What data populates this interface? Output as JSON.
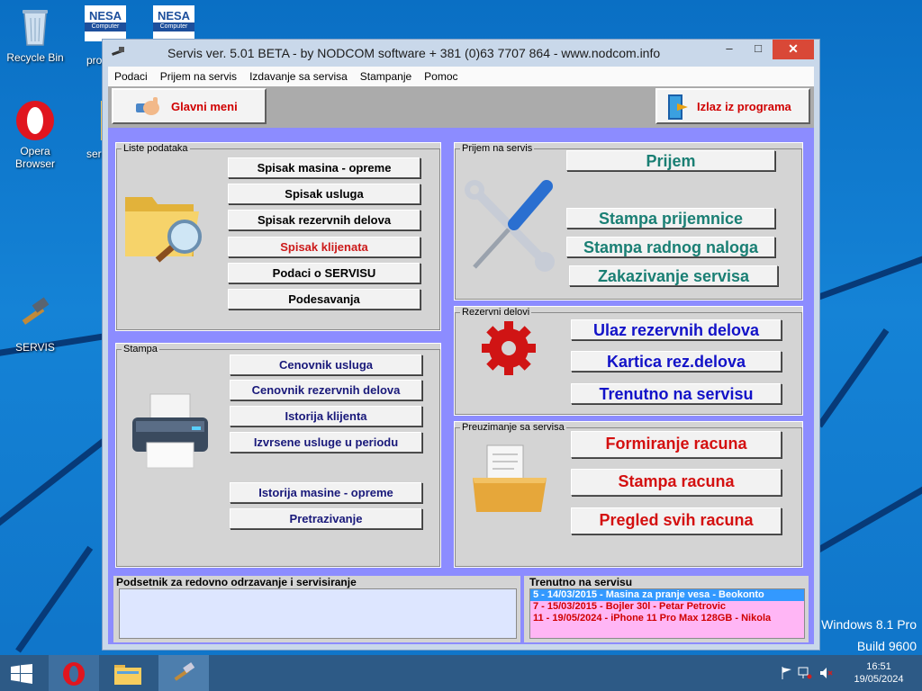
{
  "desktop": {
    "icons": {
      "recycle": "Recycle Bin",
      "nesa1": "NESA",
      "nesa1_sub": "Computer",
      "nesa1_label": "pro",
      "nesa2": "NESA",
      "nesa2_sub": "Computer",
      "opera": "Opera Browser",
      "folder_label": "ser",
      "servis": "SERVIS"
    },
    "watermark_line1": "Windows 8.1 Pro",
    "watermark_line2": "Build 9600"
  },
  "window": {
    "title": "Servis ver. 5.01 BETA - by NODCOM software  + 381 (0)63 7707 864 - www.nodcom.info",
    "controls": {
      "minimize": "–",
      "maximize": "□",
      "close": "✕"
    },
    "menu": [
      "Podaci",
      "Prijem na servis",
      "Izdavanje sa servisa",
      "Stampanje",
      "Pomoc"
    ],
    "toolbar": {
      "main_menu": "Glavni meni",
      "exit": "Izlaz iz programa"
    }
  },
  "panels": {
    "liste": {
      "caption": "Liste podataka",
      "buttons": [
        "Spisak masina - opreme",
        "Spisak usluga",
        "Spisak rezervnih delova",
        "Spisak klijenata",
        "Podaci o SERVISU",
        "Podesavanja"
      ]
    },
    "stampa": {
      "caption": "Stampa",
      "buttons": [
        "Cenovnik usluga",
        "Cenovnik rezervnih delova",
        "Istorija klijenta",
        "Izvrsene usluge u periodu",
        "Istorija masine - opreme",
        "Pretrazivanje"
      ]
    },
    "prijem": {
      "caption": "Prijem na servis",
      "buttons": [
        "Prijem",
        "Stampa prijemnice",
        "Stampa radnog naloga",
        "Zakazivanje servisa"
      ]
    },
    "rezervni": {
      "caption": "Rezervni delovi",
      "buttons": [
        "Ulaz rezervnih delova",
        "Kartica rez.delova",
        "Trenutno na servisu"
      ]
    },
    "preuzimanje": {
      "caption": "Preuzimanje sa servisa",
      "buttons": [
        "Formiranje racuna",
        "Stampa racuna",
        "Pregled svih racuna"
      ]
    }
  },
  "bottom": {
    "reminder_caption": "Podsetnik za redovno odrzavanje i servisiranje",
    "current_caption": "Trenutno na servisu",
    "current_items": [
      "5 - 14/03/2015 - Masina za pranje vesa - Beokonto",
      "7 - 15/03/2015 - Bojler 30l - Petar Petrovic",
      "11 - 19/05/2024 - iPhone 11 Pro Max 128GB - Nikola"
    ]
  },
  "taskbar": {
    "time": "16:51",
    "date": "19/05/2024"
  },
  "colors": {
    "accent_blue": "#1212c8",
    "teal": "#1a7f74",
    "red": "#d41010",
    "client_bg": "#8c8cff"
  }
}
